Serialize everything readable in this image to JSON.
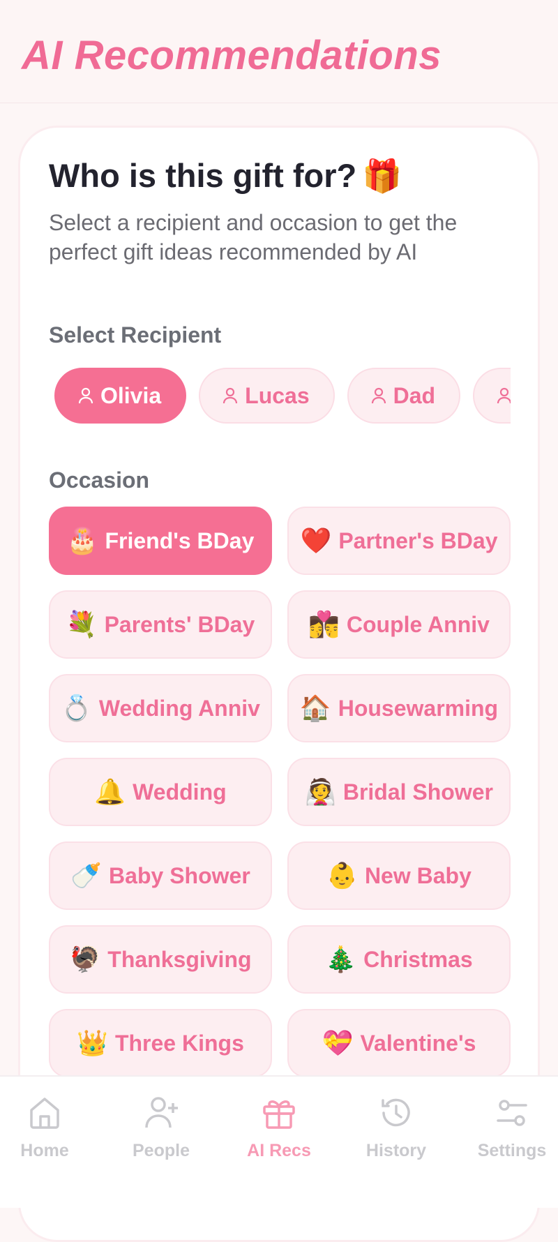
{
  "header": {
    "title": "AI Recommendations"
  },
  "card": {
    "title": "Who is this gift for?",
    "title_emoji": "🎁",
    "subtitle": "Select a recipient and occasion to get the perfect gift ideas recommended by AI"
  },
  "recipients": {
    "label": "Select Recipient",
    "items": [
      {
        "name": "",
        "selected": false
      },
      {
        "name": "Olivia",
        "selected": true
      },
      {
        "name": "Lucas",
        "selected": false
      },
      {
        "name": "Dad",
        "selected": false
      },
      {
        "name": "",
        "selected": false
      }
    ]
  },
  "occasions": {
    "label": "Occasion",
    "items": [
      {
        "emoji": "🎂",
        "label": "Friend's BDay",
        "selected": true
      },
      {
        "emoji": "❤️",
        "label": "Partner's BDay",
        "selected": false
      },
      {
        "emoji": "💐",
        "label": "Parents' BDay",
        "selected": false
      },
      {
        "emoji": "👩‍❤️‍💋‍👨",
        "label": "Couple Anniv",
        "selected": false
      },
      {
        "emoji": "💍",
        "label": "Wedding Anniv",
        "selected": false
      },
      {
        "emoji": "🏠",
        "label": "Housewarming",
        "selected": false
      },
      {
        "emoji": "🔔",
        "label": "Wedding",
        "selected": false
      },
      {
        "emoji": "👰",
        "label": "Bridal Shower",
        "selected": false
      },
      {
        "emoji": "🍼",
        "label": "Baby Shower",
        "selected": false
      },
      {
        "emoji": "👶",
        "label": "New Baby",
        "selected": false
      },
      {
        "emoji": "🦃",
        "label": "Thanksgiving",
        "selected": false
      },
      {
        "emoji": "🎄",
        "label": "Christmas",
        "selected": false
      },
      {
        "emoji": "👑",
        "label": "Three Kings",
        "selected": false
      },
      {
        "emoji": "💝",
        "label": "Valentine's",
        "selected": false
      }
    ]
  },
  "tabbar": {
    "active": "ai-recs",
    "items": [
      {
        "label": "Home",
        "icon": "home-icon"
      },
      {
        "label": "People",
        "icon": "add-person-icon"
      },
      {
        "label": "AI Recs",
        "icon": "gift-icon"
      },
      {
        "label": "History",
        "icon": "history-icon"
      },
      {
        "label": "Settings",
        "icon": "sliders-icon"
      }
    ]
  },
  "colors": {
    "accent": "#f56f93",
    "accent_text": "#ef6f97",
    "chip_bg": "#fdeef1",
    "inactive_tab": "#c9c9cd"
  }
}
